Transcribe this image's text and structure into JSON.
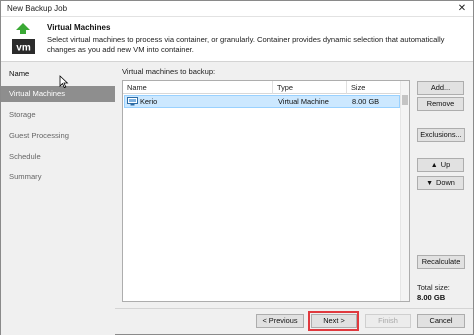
{
  "window": {
    "title": "New Backup Job",
    "close_glyph": "✕"
  },
  "header": {
    "logo_text": "vm",
    "title": "Virtual Machines",
    "description": "Select virtual machines to process via container, or granularly. Container provides dynamic selection that automatically changes as you add new VM into container."
  },
  "nav": {
    "items": [
      {
        "label": "Name"
      },
      {
        "label": "Virtual Machines"
      },
      {
        "label": "Storage"
      },
      {
        "label": "Guest Processing"
      },
      {
        "label": "Schedule"
      },
      {
        "label": "Summary"
      }
    ],
    "active_index": 1
  },
  "vm_list": {
    "section_label": "Virtual machines to backup:",
    "columns": {
      "name": "Name",
      "type": "Type",
      "size": "Size"
    },
    "rows": [
      {
        "name": "Kerio",
        "type": "Virtual Machine",
        "size": "8.00 GB"
      }
    ]
  },
  "side_buttons": {
    "add": "Add...",
    "remove": "Remove",
    "exclusions": "Exclusions...",
    "up": "Up",
    "down": "Down",
    "recalculate": "Recalculate"
  },
  "total": {
    "label": "Total size:",
    "value": "8.00 GB"
  },
  "footer": {
    "previous": "< Previous",
    "next": "Next >",
    "finish": "Finish",
    "cancel": "Cancel"
  },
  "colors": {
    "active_nav": "#8e8e8e",
    "selected_row": "#cce8ff",
    "logo_green": "#3aa935",
    "highlight": "#e0393e"
  },
  "icons": {
    "window_close": "close-icon",
    "logo": "vm-logo-icon",
    "vm_row": "virtual-machine-icon",
    "up": "arrow-up-icon",
    "down": "arrow-down-icon"
  }
}
